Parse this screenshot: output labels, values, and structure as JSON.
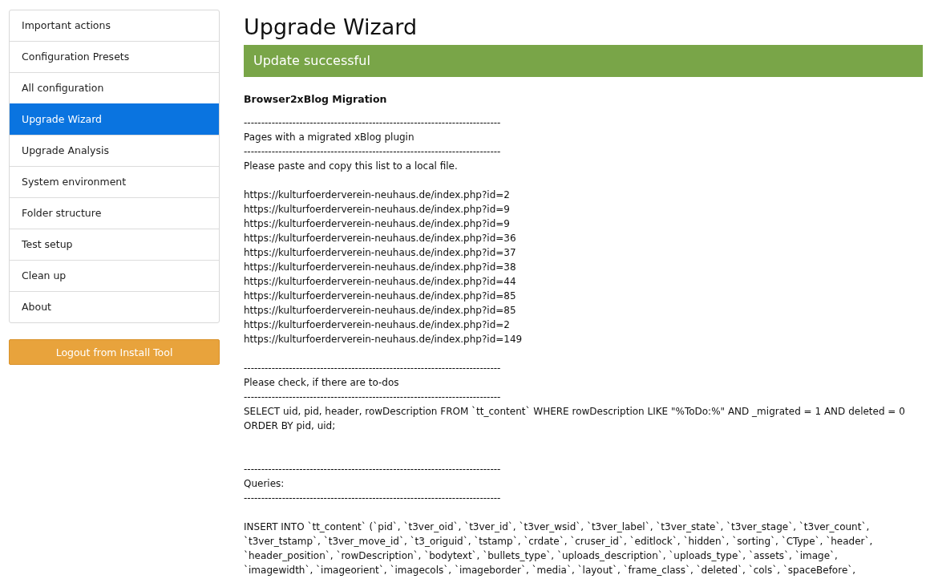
{
  "sidebar": {
    "items": [
      {
        "label": "Important actions",
        "selected": false
      },
      {
        "label": "Configuration Presets",
        "selected": false
      },
      {
        "label": "All configuration",
        "selected": false
      },
      {
        "label": "Upgrade Wizard",
        "selected": true
      },
      {
        "label": "Upgrade Analysis",
        "selected": false
      },
      {
        "label": "System environment",
        "selected": false
      },
      {
        "label": "Folder structure",
        "selected": false
      },
      {
        "label": "Test setup",
        "selected": false
      },
      {
        "label": "Clean up",
        "selected": false
      },
      {
        "label": "About",
        "selected": false
      }
    ],
    "logout_button": "Logout from Install Tool"
  },
  "main": {
    "title": "Upgrade Wizard",
    "alert": {
      "kind": "success",
      "text": "Update successful"
    },
    "section_heading": "Browser2xBlog Migration",
    "output": [
      {
        "kind": "text",
        "text": "--------------------------------------------------------------------------"
      },
      {
        "kind": "text",
        "text": "Pages with a migrated xBlog plugin"
      },
      {
        "kind": "text",
        "text": "--------------------------------------------------------------------------"
      },
      {
        "kind": "text",
        "text": "Please paste and copy this list to a local file."
      },
      {
        "kind": "blank"
      },
      {
        "kind": "text",
        "text": "https://kulturfoerderverein-neuhaus.de/index.php?id=2"
      },
      {
        "kind": "text",
        "text": "https://kulturfoerderverein-neuhaus.de/index.php?id=9"
      },
      {
        "kind": "text",
        "text": "https://kulturfoerderverein-neuhaus.de/index.php?id=9"
      },
      {
        "kind": "text",
        "text": "https://kulturfoerderverein-neuhaus.de/index.php?id=36"
      },
      {
        "kind": "text",
        "text": "https://kulturfoerderverein-neuhaus.de/index.php?id=37"
      },
      {
        "kind": "text",
        "text": "https://kulturfoerderverein-neuhaus.de/index.php?id=38"
      },
      {
        "kind": "text",
        "text": "https://kulturfoerderverein-neuhaus.de/index.php?id=44"
      },
      {
        "kind": "text",
        "text": "https://kulturfoerderverein-neuhaus.de/index.php?id=85"
      },
      {
        "kind": "text",
        "text": "https://kulturfoerderverein-neuhaus.de/index.php?id=85"
      },
      {
        "kind": "text",
        "text": "https://kulturfoerderverein-neuhaus.de/index.php?id=2"
      },
      {
        "kind": "text",
        "text": "https://kulturfoerderverein-neuhaus.de/index.php?id=149"
      },
      {
        "kind": "blank"
      },
      {
        "kind": "text",
        "text": "--------------------------------------------------------------------------"
      },
      {
        "kind": "text",
        "text": "Please check, if there are to-dos"
      },
      {
        "kind": "text",
        "text": "--------------------------------------------------------------------------"
      },
      {
        "kind": "text",
        "text": "SELECT uid, pid, header, rowDescription FROM `tt_content` WHERE rowDescription LIKE \"%ToDo:%\" AND _migrated = 1 AND deleted = 0 ORDER BY pid, uid;"
      },
      {
        "kind": "blank"
      },
      {
        "kind": "blank"
      },
      {
        "kind": "text",
        "text": "--------------------------------------------------------------------------"
      },
      {
        "kind": "text",
        "text": "Queries:"
      },
      {
        "kind": "text",
        "text": "--------------------------------------------------------------------------"
      },
      {
        "kind": "blank"
      },
      {
        "kind": "text",
        "text": "INSERT INTO `tt_content` (`pid`, `t3ver_oid`, `t3ver_id`, `t3ver_wsid`, `t3ver_label`, `t3ver_state`, `t3ver_stage`, `t3ver_count`,"
      },
      {
        "kind": "text",
        "text": "`t3ver_tstamp`, `t3ver_move_id`, `t3_origuid`, `tstamp`, `crdate`, `cruser_id`, `editlock`, `hidden`, `sorting`, `CType`, `header`,"
      },
      {
        "kind": "text",
        "text": "`header_position`, `rowDescription`, `bodytext`, `bullets_type`, `uploads_description`, `uploads_type`, `assets`, `image`,"
      },
      {
        "kind": "text",
        "text": "`imagewidth`, `imageorient`, `imagecols`, `imageborder`, `media`, `layout`, `frame_class`, `deleted`, `cols`, `spaceBefore`,"
      }
    ]
  }
}
